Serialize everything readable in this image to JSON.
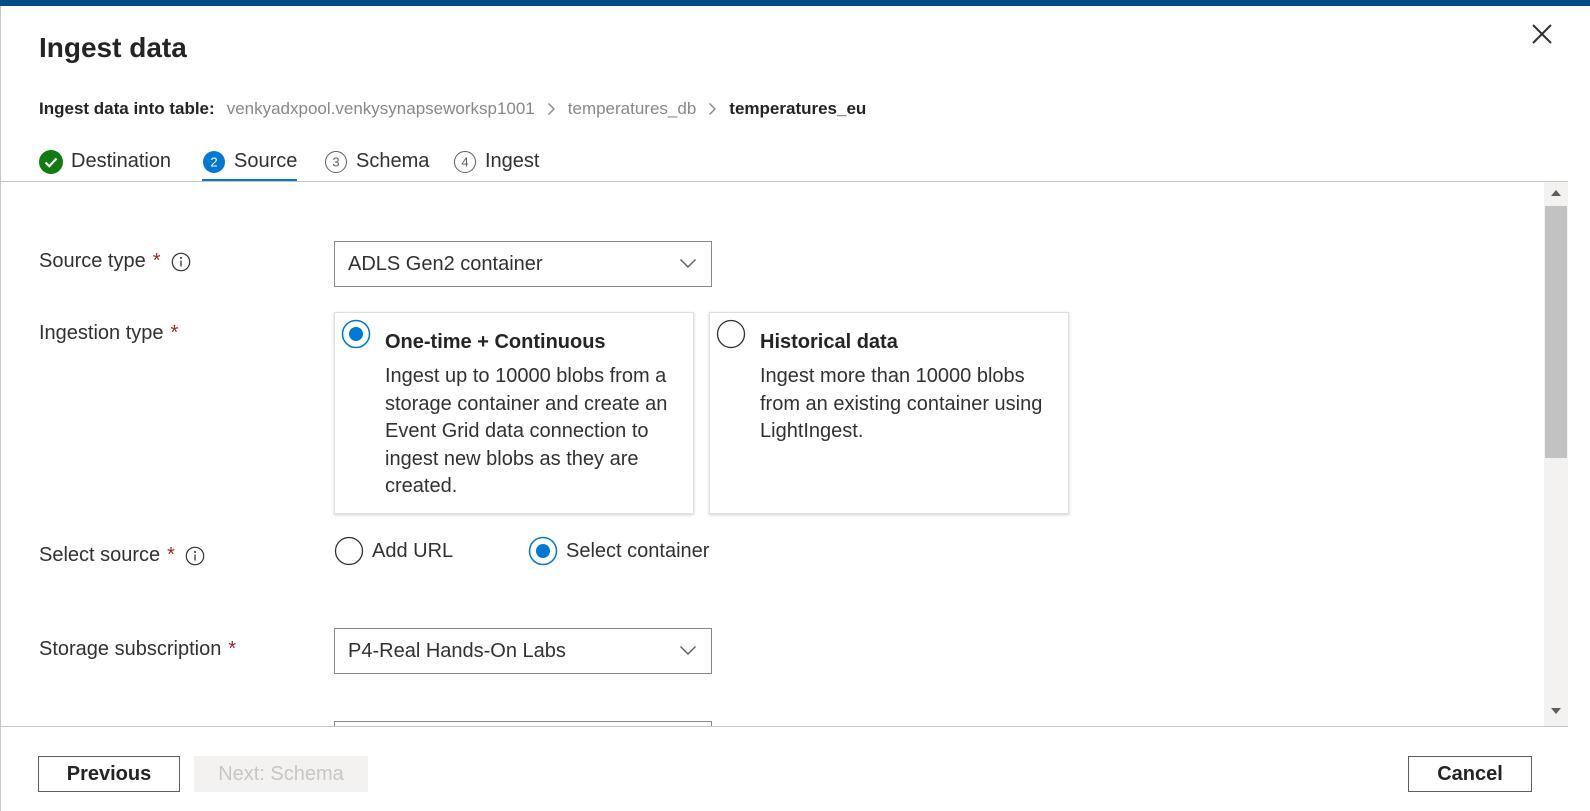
{
  "dialog": {
    "title": "Ingest data",
    "close_icon": "close-icon"
  },
  "breadcrumb": {
    "prefix": "Ingest data into table:",
    "items": [
      "venkyadxpool.venkysynapseworksp1001",
      "temperatures_db"
    ],
    "current": "temperatures_eu"
  },
  "tabs": [
    {
      "label": "Destination",
      "step": "",
      "state": "completed"
    },
    {
      "label": "Source",
      "step": "2",
      "state": "active"
    },
    {
      "label": "Schema",
      "step": "3",
      "state": "pending"
    },
    {
      "label": "Ingest",
      "step": "4",
      "state": "pending"
    }
  ],
  "form": {
    "source_type": {
      "label": "Source type",
      "required_mark": "*",
      "value": "ADLS Gen2 container"
    },
    "ingestion_type": {
      "label": "Ingestion type",
      "required_mark": "*",
      "options": [
        {
          "title": "One-time + Continuous",
          "description": "Ingest up to 10000 blobs from a storage container and create an Event Grid data connection to ingest new blobs as they are created.",
          "selected": true
        },
        {
          "title": "Historical data",
          "description": "Ingest more than 10000 blobs from an existing container using LightIngest.",
          "selected": false
        }
      ]
    },
    "select_source": {
      "label": "Select source",
      "required_mark": "*",
      "options": [
        {
          "label": "Add URL",
          "selected": false
        },
        {
          "label": "Select container",
          "selected": true
        }
      ]
    },
    "storage_subscription": {
      "label": "Storage subscription",
      "required_mark": "*",
      "value": "P4-Real Hands-On Labs"
    }
  },
  "footer": {
    "previous_label": "Previous",
    "next_label": "Next: Schema",
    "cancel_label": "Cancel"
  },
  "colors": {
    "accent": "#0078d4",
    "topbar": "#004b88",
    "success": "#107c10",
    "required": "#a4262c"
  }
}
